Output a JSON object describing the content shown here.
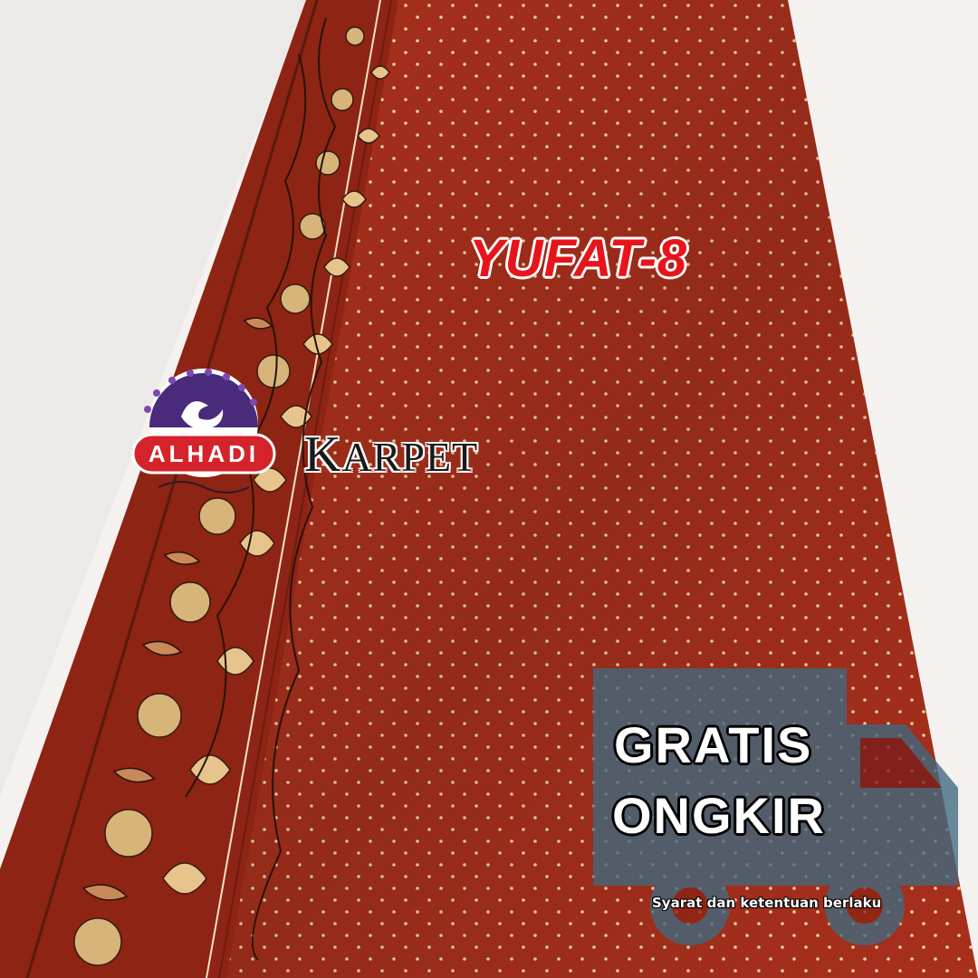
{
  "product": {
    "code": "YUFAT-8"
  },
  "brand": {
    "badge_text": "ALHADI",
    "word_first": "K",
    "word_rest": "ARPET"
  },
  "promo": {
    "line1": "GRATIS",
    "line2": "ONGKIR",
    "note": "Syarat dan ketentuan berlaku"
  },
  "colors": {
    "carpet": "#a8301c",
    "carpet_dark": "#7e1e12",
    "dots": "#f0d9a8",
    "code_red": "#e8141c",
    "badge_purple": "#4a2a7a",
    "badge_red": "#d4232a",
    "truck": "#3f6a80"
  }
}
